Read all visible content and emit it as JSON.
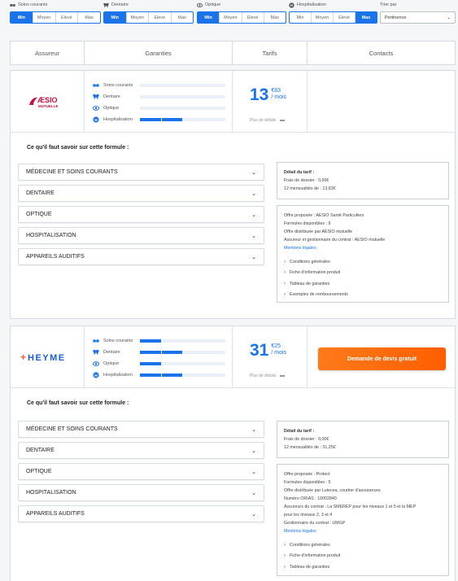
{
  "filters": [
    {
      "label": "Soins courants",
      "icon": "soins-icon",
      "options": [
        "Min",
        "Moyen",
        "Elevé",
        "Max"
      ],
      "selected": 0
    },
    {
      "label": "Dentaire",
      "icon": "dentaire-icon",
      "options": [
        "Min",
        "Moyen",
        "Elevé",
        "Max"
      ],
      "selected": 0
    },
    {
      "label": "Optique",
      "icon": "optique-icon",
      "options": [
        "Min",
        "Moyen",
        "Elevé",
        "Max"
      ],
      "selected": 0
    },
    {
      "label": "Hospitalisation",
      "icon": "hospitalisation-icon",
      "options": [
        "Min",
        "Moyen",
        "Elevé",
        "Max"
      ],
      "selected": 3
    }
  ],
  "sort": {
    "label": "Trier par",
    "value": "Pertinence"
  },
  "tabs": {
    "assureur": "Assureur",
    "garanties": "Garanties",
    "tarifs": "Tarifs",
    "contacts": "Contacts"
  },
  "garantie_labels": [
    "Soins courants",
    "Dentaire",
    "Optique",
    "Hospitalisation"
  ],
  "offers": [
    {
      "logo": "AÉSIO MUTUELLE",
      "logo_main": "ÆSIO",
      "logo_sub": "MUTUELLE",
      "levels": [
        0,
        0,
        0,
        2
      ],
      "price_int": "13",
      "price_dec": "€83",
      "price_unit": "/ mois",
      "details": "Plus de détails",
      "has_devis": false,
      "section_title": "Ce qu'il faut savoir sur cette formule :",
      "accordions": [
        "MÉDECINE ET SOINS COURANTS",
        "DENTAIRE",
        "OPTIQUE",
        "HOSPITALISATION",
        "APPAREILS AUDITIFS"
      ],
      "tarif": {
        "title": "Détail du tarif :",
        "lines": [
          "Frais de dossier : 0,00€",
          "12 mensualités de : 13,83€"
        ]
      },
      "info": [
        "Offre proposée : AESIO Santé Particuliers",
        "Formules disponibles : 9",
        "Offre distribuée par AÉSIO mutuelle",
        "Assureur et gestionnaire du contrat : AESIO mutuelle"
      ],
      "legal": "Mentions légales",
      "docs": [
        "Conditions générales",
        "Fiche d'information produit",
        "Tableau de garanties",
        "Exemples de remboursements"
      ]
    },
    {
      "logo": "HEYME",
      "logo_main": "HEYME",
      "levels": [
        1,
        2,
        1,
        2
      ],
      "price_int": "31",
      "price_dec": "€25",
      "price_unit": "/ mois",
      "details": "Plus de détails",
      "has_devis": true,
      "devis": "Demande de devis gratuit",
      "section_title": "Ce qu'il faut savoir sur cette formule :",
      "accordions": [
        "MÉDECINE ET SOINS COURANTS",
        "DENTAIRE",
        "OPTIQUE",
        "HOSPITALISATION",
        "APPAREILS AUDITIFS"
      ],
      "tarif": {
        "title": "Détail du tarif :",
        "lines": [
          "Frais de dossier : 0,00€",
          "12 mensualités de : 31,25€"
        ]
      },
      "info": [
        "Offre proposée : Protect",
        "Formules disponibles : 5",
        "Offre distribuée par Lutecea, courtier d'assurances",
        "Numéro ORIAS : 19002840",
        "Assureurs du contrat : La SMEREP pour les niveaux 1 et 5 et la MEP",
        "pour les niveaux 2, 3 et 4",
        "Gestionnaire du contrat : UMGP"
      ],
      "legal": "Mentions légales",
      "docs": [
        "Conditions générales",
        "Fiche d'information produit",
        "Tableau de garanties"
      ]
    }
  ],
  "colors": {
    "accent": "#1a73e8",
    "cta": "#ff6a00",
    "aesio": "#c8103e",
    "heyme_orange": "#ff5a36",
    "heyme_blue": "#1e5bd8"
  }
}
